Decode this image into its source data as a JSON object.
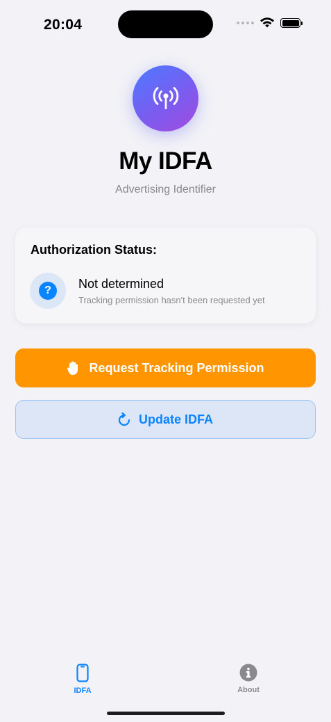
{
  "status_bar": {
    "time": "20:04"
  },
  "header": {
    "title": "My IDFA",
    "subtitle": "Advertising Identifier",
    "icon": "antenna-radiowaves-icon",
    "gradient_colors": [
      "#4b7bff",
      "#a44bdf"
    ]
  },
  "authorization_card": {
    "title": "Authorization Status:",
    "status_icon": "question-mark-circle-icon",
    "status": "Not determined",
    "description": "Tracking permission hasn't been requested yet"
  },
  "buttons": {
    "request": {
      "label": "Request Tracking Permission",
      "icon": "hand-raised-icon",
      "color": "#ff9500"
    },
    "update": {
      "label": "Update IDFA",
      "icon": "arrow-clockwise-icon",
      "color": "#0a84ff"
    }
  },
  "tab_bar": {
    "tabs": [
      {
        "label": "IDFA",
        "icon": "iphone-icon",
        "selected": true
      },
      {
        "label": "About",
        "icon": "info-circle-icon",
        "selected": false
      }
    ],
    "accent_color": "#0a84ff"
  }
}
